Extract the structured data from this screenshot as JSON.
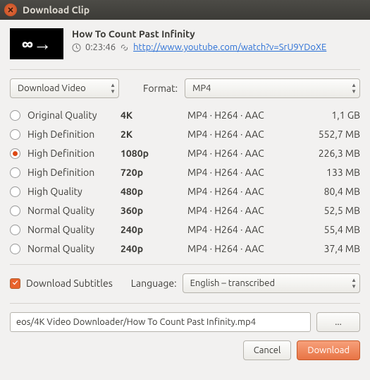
{
  "window": {
    "title": "Download Clip"
  },
  "video": {
    "title": "How To Count Past Infinity",
    "duration": "0:23:46",
    "url": "http://www.youtube.com/watch?v=SrU9YDoXE"
  },
  "controls": {
    "mode_label": "Download Video",
    "format_label": "Format:",
    "format_value": "MP4"
  },
  "qualities": [
    {
      "label": "Original Quality",
      "res": "4K",
      "codec": "MP4 · H264 · AAC",
      "size": "1,1 GB",
      "selected": false
    },
    {
      "label": "High Definition",
      "res": "2K",
      "codec": "MP4 · H264 · AAC",
      "size": "552,7 MB",
      "selected": false
    },
    {
      "label": "High Definition",
      "res": "1080p",
      "codec": "MP4 · H264 · AAC",
      "size": "226,3 MB",
      "selected": true
    },
    {
      "label": "High Definition",
      "res": "720p",
      "codec": "MP4 · H264 · AAC",
      "size": "133 MB",
      "selected": false
    },
    {
      "label": "High Quality",
      "res": "480p",
      "codec": "MP4 · H264 · AAC",
      "size": "80,4 MB",
      "selected": false
    },
    {
      "label": "Normal Quality",
      "res": "360p",
      "codec": "MP4 · H264 · AAC",
      "size": "52,5 MB",
      "selected": false
    },
    {
      "label": "Normal Quality",
      "res": "240p",
      "codec": "MP4 · H264 · AAC",
      "size": "55,4 MB",
      "selected": false
    },
    {
      "label": "Normal Quality",
      "res": "240p",
      "codec": "MP4 · H264 · AAC",
      "size": "37,4 MB",
      "selected": false
    }
  ],
  "subtitles": {
    "checked": true,
    "label": "Download Subtitles",
    "language_label": "Language:",
    "language_value": "English – transcribed"
  },
  "path": {
    "value": "eos/4K Video Downloader/How To Count Past Infinity.mp4",
    "browse": "..."
  },
  "actions": {
    "cancel": "Cancel",
    "download": "Download"
  },
  "thumb_glyph": "∞→"
}
